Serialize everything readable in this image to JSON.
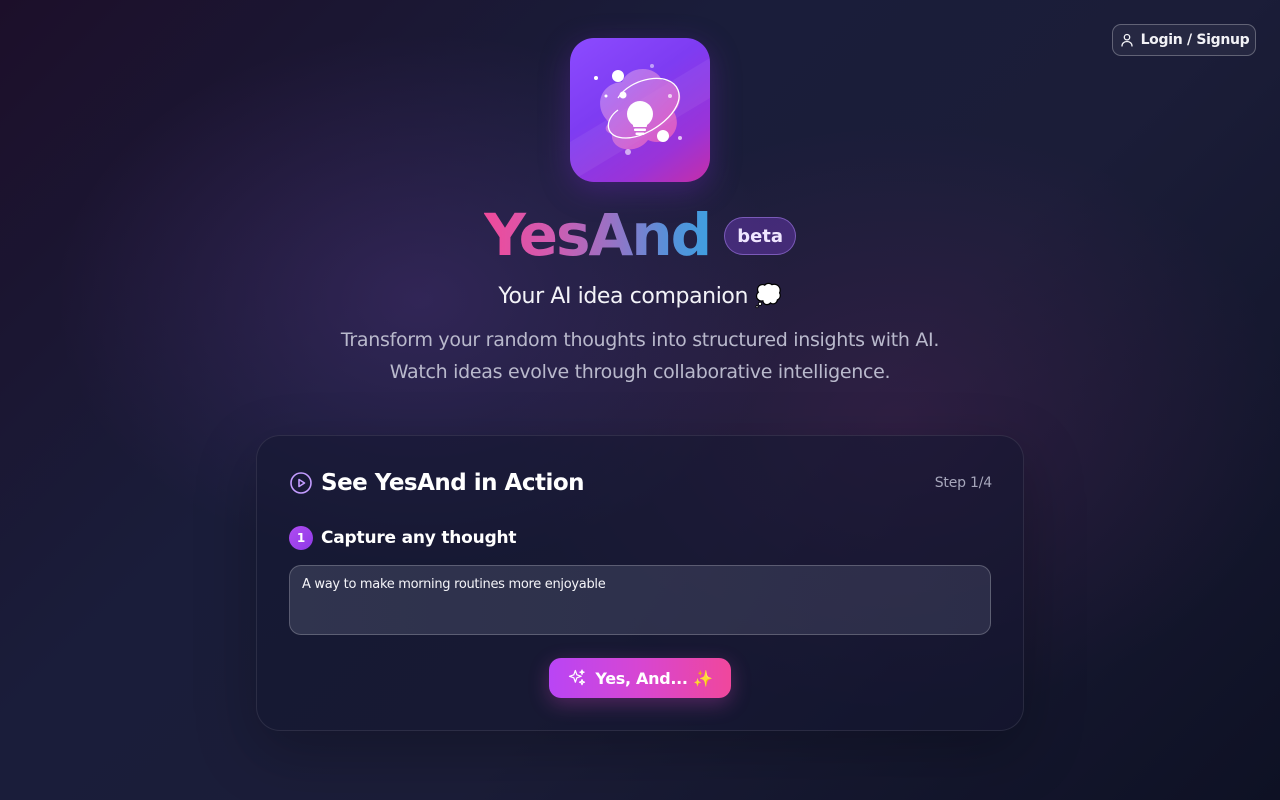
{
  "header": {
    "login_label": "Login / Signup",
    "login_icon": "user-icon"
  },
  "hero": {
    "logo_icon": "lightbulb-icon",
    "brand": "YesAnd",
    "badge": "beta",
    "tagline": "Your AI idea companion 💭",
    "description_line1": "Transform your random thoughts into structured insights with AI.",
    "description_line2": "Watch ideas evolve through collaborative intelligence."
  },
  "demo": {
    "title": "See YesAnd in Action",
    "title_icon": "play-circle-icon",
    "step_indicator": "Step 1/4",
    "step_number": "1",
    "step_label": "Capture any thought",
    "input_value": "A way to make morning routines more enjoyable",
    "button_label": "Yes, And... ✨",
    "button_icon": "sparkles-icon"
  },
  "colors": {
    "accent_purple": "#b945f5",
    "accent_pink": "#f0479c",
    "brand_gradient_start": "#ef4a9b",
    "brand_gradient_end": "#3f9fe0"
  }
}
